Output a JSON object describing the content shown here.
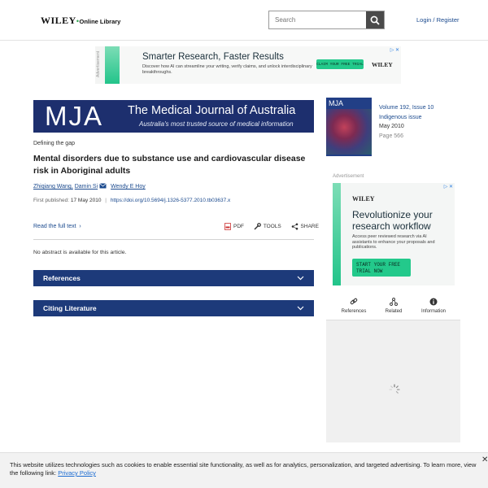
{
  "header": {
    "logo_main": "WILEY",
    "logo_sub": "Online Library",
    "search_placeholder": "Search",
    "login_label": "Login / Register"
  },
  "top_ad": {
    "label": "Advertisement",
    "headline": "Smarter Research, Faster Results",
    "subtext": "Discover how AI can streamline your writing, verify claims, and unlock interdisciplinary breakthroughs.",
    "cta": "CLAIM YOUR FREE TRIAL",
    "brand": "WILEY"
  },
  "journal_banner": {
    "abbrev": "MJA",
    "name": "The Medical Journal of Australia",
    "tagline": "Australia's most trusted source of medical information"
  },
  "article": {
    "section": "Defining the gap",
    "title": "Mental disorders due to substance use and cardiovascular disease risk in Aboriginal adults",
    "authors": [
      "Zhiqiang Wang,",
      "Damin Si",
      "Wendy E Hoy"
    ],
    "first_published_label": "First published:",
    "first_published_date": "17 May 2010",
    "separator": "|",
    "doi": "https://doi.org/10.5694/j.1326-5377.2010.tb03637.x",
    "read_full": "Read the full text",
    "tools": {
      "pdf": "PDF",
      "tools": "TOOLS",
      "share": "SHARE"
    },
    "no_abstract": "No abstract is available for this article."
  },
  "accordions": [
    {
      "label": "References"
    },
    {
      "label": "Citing Literature"
    }
  ],
  "issue": {
    "cover_title": "MJA",
    "volume": "Volume 192, Issue 10",
    "issue_name": "Indigenous issue",
    "date": "May 2010",
    "pages": "Page 566"
  },
  "side_ad": {
    "label": "Advertisement",
    "brand": "WILEY",
    "headline": "Revolutionize your research workflow",
    "subtext": "Access peer reviewed research via AI assistants to enhance your proposals and publications.",
    "cta": "START YOUR FREE TRIAL NOW"
  },
  "side_tabs": [
    {
      "label": "References",
      "icon": "link-icon"
    },
    {
      "label": "Related",
      "icon": "related-icon"
    },
    {
      "label": "Information",
      "icon": "info-icon"
    }
  ],
  "cookie": {
    "text": "This website utilizes technologies such as cookies to enable essential site functionality, as well as for analytics, personalization, and targeted advertising. To learn more, view the following link:",
    "link": "Privacy Policy",
    "close": "✕"
  },
  "colors": {
    "accent": "#1d3a7a",
    "link": "#1b4a8e",
    "ad_green": "#23c98b"
  }
}
